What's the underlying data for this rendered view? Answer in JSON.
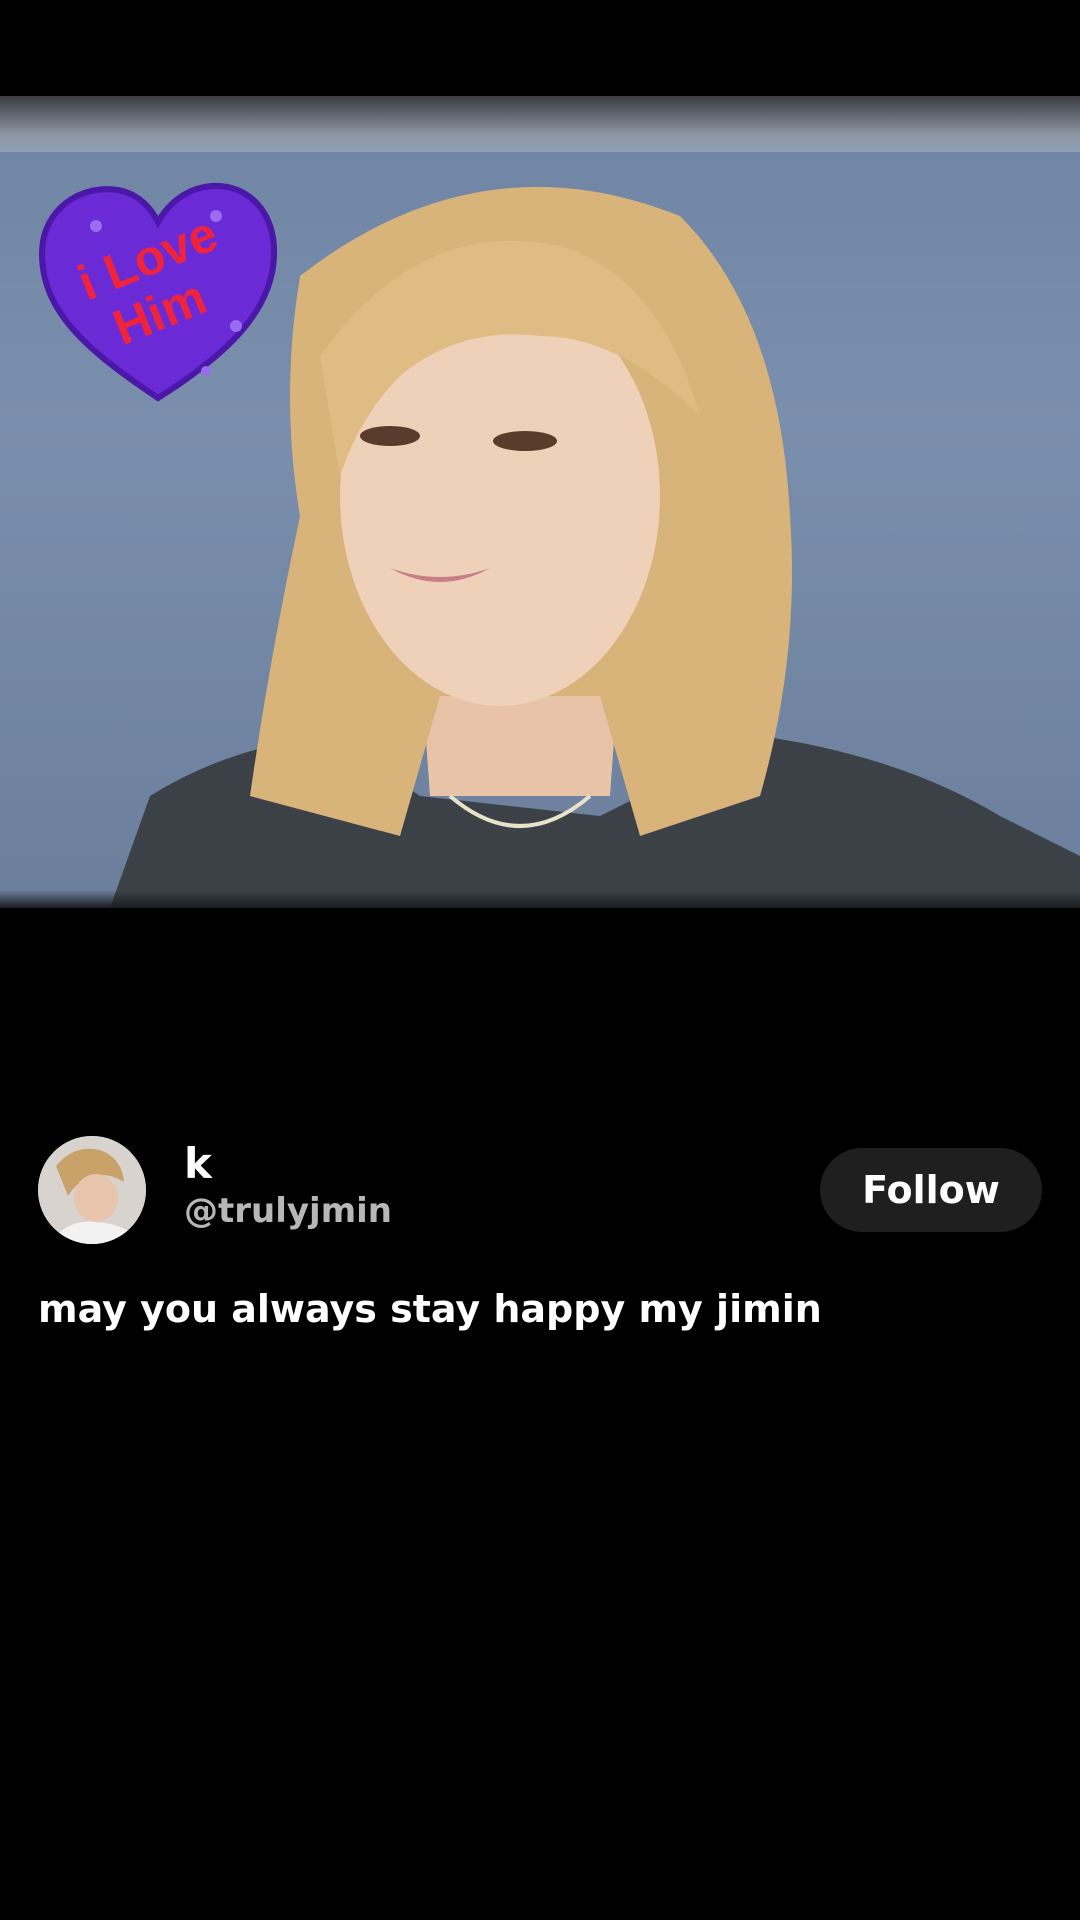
{
  "video": {
    "sticker_text_line1": "i Love",
    "sticker_text_line2": "Him",
    "sticker_color": "#6a2bd6",
    "sticker_text_color": "#f0233d"
  },
  "post": {
    "display_name": "k",
    "handle": "@trulyjmin",
    "follow_label": "Follow",
    "caption": "may you always stay happy my jimin"
  },
  "icons": {
    "avatar": "avatar-photo"
  },
  "colors": {
    "background": "#000000",
    "follow_button_bg": "#1f1f1f",
    "handle_text": "#b7b7b7"
  }
}
